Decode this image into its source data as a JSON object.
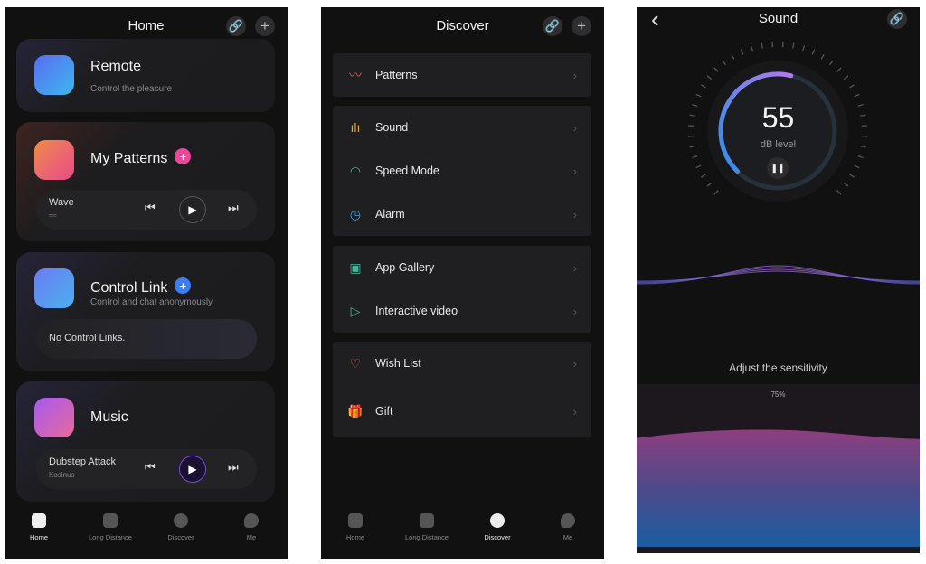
{
  "home": {
    "title": "Home",
    "header_buttons": [
      {
        "icon": "link-icon",
        "glyph": "🔗"
      },
      {
        "icon": "plus-icon",
        "glyph": "+"
      }
    ],
    "cards": {
      "remote": {
        "title": "Remote",
        "subtitle": "Control the pleasure"
      },
      "patterns": {
        "title": "My Patterns",
        "add": "+",
        "player": {
          "track": "Wave"
        }
      },
      "control_link": {
        "title": "Control Link",
        "add": "+",
        "subtitle": "Control and chat anonymously",
        "empty": "No Control Links."
      },
      "music": {
        "title": "Music",
        "player": {
          "track": "Dubstep Attack",
          "artist": "Kosinus"
        }
      }
    },
    "player_glyphs": {
      "prev": "⏮",
      "play": "▶",
      "next": "⏭"
    }
  },
  "discover": {
    "title": "Discover",
    "groups": [
      [
        {
          "label": "Patterns",
          "icon": "wave-circle-icon",
          "glyph": "〰",
          "color": "#e0565b"
        }
      ],
      [
        {
          "label": "Sound",
          "icon": "sound-bars-icon",
          "glyph": "ılı",
          "color": "#e8a23a"
        },
        {
          "label": "Speed Mode",
          "icon": "speedometer-icon",
          "glyph": "◠",
          "color": "#3fb59a"
        },
        {
          "label": "Alarm",
          "icon": "clock-icon",
          "glyph": "◷",
          "color": "#3a9ee0"
        }
      ],
      [
        {
          "label": "App Gallery",
          "icon": "gallery-icon",
          "glyph": "▣",
          "color": "#3fb59a"
        },
        {
          "label": "Interactive video",
          "icon": "play-circle-icon",
          "glyph": "▷",
          "color": "#3fb59a"
        }
      ],
      [
        {
          "label": "Wish List",
          "icon": "heart-icon",
          "glyph": "♡",
          "color": "#e0565b"
        },
        {
          "label": "Gift",
          "icon": "gift-icon",
          "glyph": "🎁",
          "color": "#e8a23a"
        }
      ]
    ],
    "chevron": "›"
  },
  "nav": [
    {
      "label": "Home",
      "icon": "home-icon"
    },
    {
      "label": "Long Distance",
      "icon": "hearts-icon"
    },
    {
      "label": "Discover",
      "icon": "planet-icon"
    },
    {
      "label": "Me",
      "icon": "face-icon"
    }
  ],
  "sound": {
    "title": "Sound",
    "back": "‹",
    "link": "🔗",
    "level": "55",
    "unit": "dB level",
    "pause": "❚❚",
    "gauge_fraction": 0.55,
    "sensitivity_label": "Adjust the sensitivity",
    "sensitivity_value": "75%",
    "sensitivity_fraction": 0.75
  },
  "colors": {
    "accent_blue": "#2f8fe8",
    "accent_purple": "#a070e0",
    "accent_pink": "#e8479a"
  }
}
